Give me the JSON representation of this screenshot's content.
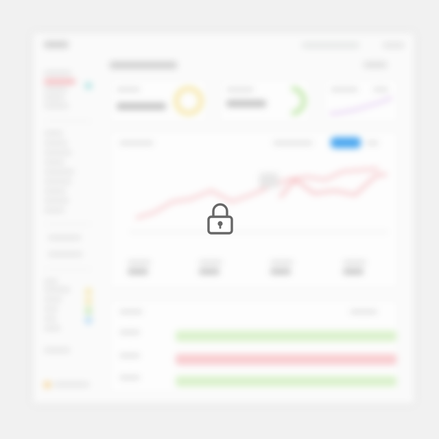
{
  "overlay": {
    "lock_icon": "lock-icon"
  },
  "colors": {
    "background": "#f1f1f1",
    "panel": "#ffffff",
    "accent_red": "#f4a3a8",
    "accent_green": "#bfe8a6",
    "accent_blue": "#3aa0f0",
    "accent_yellow": "#f7e7a1",
    "accent_teal": "#9fe1e0",
    "accent_purple": "#d9b8f0"
  }
}
